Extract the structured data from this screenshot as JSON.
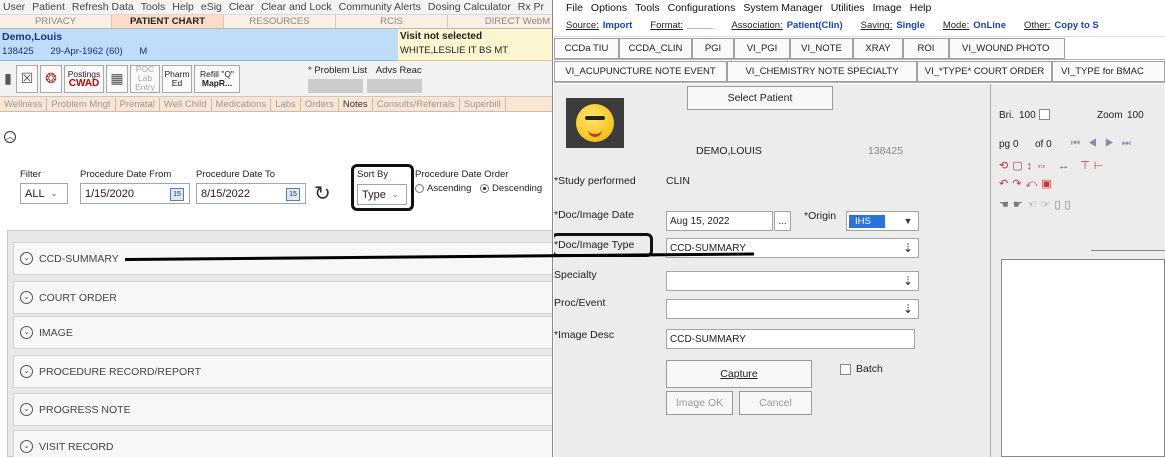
{
  "left_window": {
    "menu": [
      "User",
      "Patient",
      "Refresh Data",
      "Tools",
      "Help",
      "eSig",
      "Clear",
      "Clear and Lock",
      "Community Alerts",
      "Dosing Calculator",
      "Rx Pr"
    ],
    "top_tabs": [
      "PRIVACY",
      "PATIENT CHART",
      "RESOURCES",
      "RCIS",
      "DIRECT WebM"
    ],
    "patient": {
      "name": "Demo,Louis",
      "id": "138425",
      "dob": "29-Apr-1962 (60)",
      "sex": "M"
    },
    "visit": {
      "status": "Visit not selected",
      "provider": "WHITE,LESLIE IT BS MT"
    },
    "toolbar": {
      "postings_label": "Postings",
      "cwad_label": "CWAD",
      "poc_label": "POC Lab Entry",
      "pharm_label": "Pharm Ed",
      "refill_label": "Refill \"Q\"",
      "mapr_label": "MapR...",
      "problem_list": "* Problem List",
      "advs_react": "Advs Reac"
    },
    "sub_tabs": [
      "Wellness",
      "Problem Mngt",
      "Prenatal",
      "Well Child",
      "Medications",
      "Labs",
      "Orders",
      "Notes",
      "Consults/Referrals",
      "Superbill"
    ],
    "filters": {
      "filter_label": "Filter",
      "filter_value": "ALL",
      "date_from_label": "Procedure Date From",
      "date_from": "1/15/2020",
      "date_to_label": "Procedure Date To",
      "date_to": "8/15/2022",
      "calendar_day": "15",
      "sort_by_label": "Sort By",
      "sort_by_value": "Type",
      "order_label": "Procedure Date Order",
      "ascending": "Ascending",
      "descending": "Descending",
      "selected_order": "Descending"
    },
    "groups": [
      "CCD-SUMMARY",
      "COURT ORDER",
      "IMAGE",
      "PROCEDURE RECORD/REPORT",
      "PROGRESS NOTE",
      "VISIT RECORD"
    ]
  },
  "right_window": {
    "menu": [
      "File",
      "Options",
      "Tools",
      "Configurations",
      "System Manager",
      "Utilities",
      "Image",
      "Help"
    ],
    "source_row": [
      {
        "label": "Source:",
        "value": "Import"
      },
      {
        "label": "Format:",
        "value": "_____"
      },
      {
        "label": "Association:",
        "value": "Patient(Clin)"
      },
      {
        "label": "Saving:",
        "value": "Single"
      },
      {
        "label": "Mode:",
        "value": "OnLine"
      },
      {
        "label": "Other:",
        "value": "Copy to S"
      }
    ],
    "buttons_row1": [
      "CCDa TIU",
      "CCDA_CLIN",
      "PGI",
      "VI_PGI",
      "VI_NOTE",
      "XRAY",
      "ROI",
      "VI_WOUND PHOTO"
    ],
    "buttons_row2": [
      "VI_ACUPUNCTURE NOTE EVENT",
      "VI_CHEMISTRY NOTE SPECIALTY",
      "VI_*TYPE* COURT ORDER",
      "VI_TYPE for BMAC"
    ],
    "form": {
      "select_patient": "Select Patient",
      "patient_name": "DEMO,LOUIS",
      "patient_id": "138425",
      "study_label": "*Study performed",
      "study_value": "CLIN",
      "doc_date_label": "*Doc/Image Date",
      "doc_date_value": "Aug 15, 2022",
      "date_btn": "...",
      "origin_label": "*Origin",
      "origin_value": "IHS",
      "doc_type_label": "*Doc/Image Type",
      "doc_type_value": "CCD-SUMMARY",
      "specialty_label": "Specialty",
      "specialty_value": "",
      "proc_label": "Proc/Event",
      "proc_value": "",
      "desc_label": "*Image Desc",
      "desc_value": "CCD-SUMMARY",
      "capture": "Capture",
      "batch": "Batch",
      "image_ok": "Image OK",
      "cancel": "Cancel"
    },
    "viewer": {
      "bri_label": "Bri.",
      "bri_value": "100",
      "zoom_label": "Zoom",
      "zoom_value": "100",
      "page_label": "pg",
      "page_value": "0",
      "of_label": "of 0"
    }
  }
}
